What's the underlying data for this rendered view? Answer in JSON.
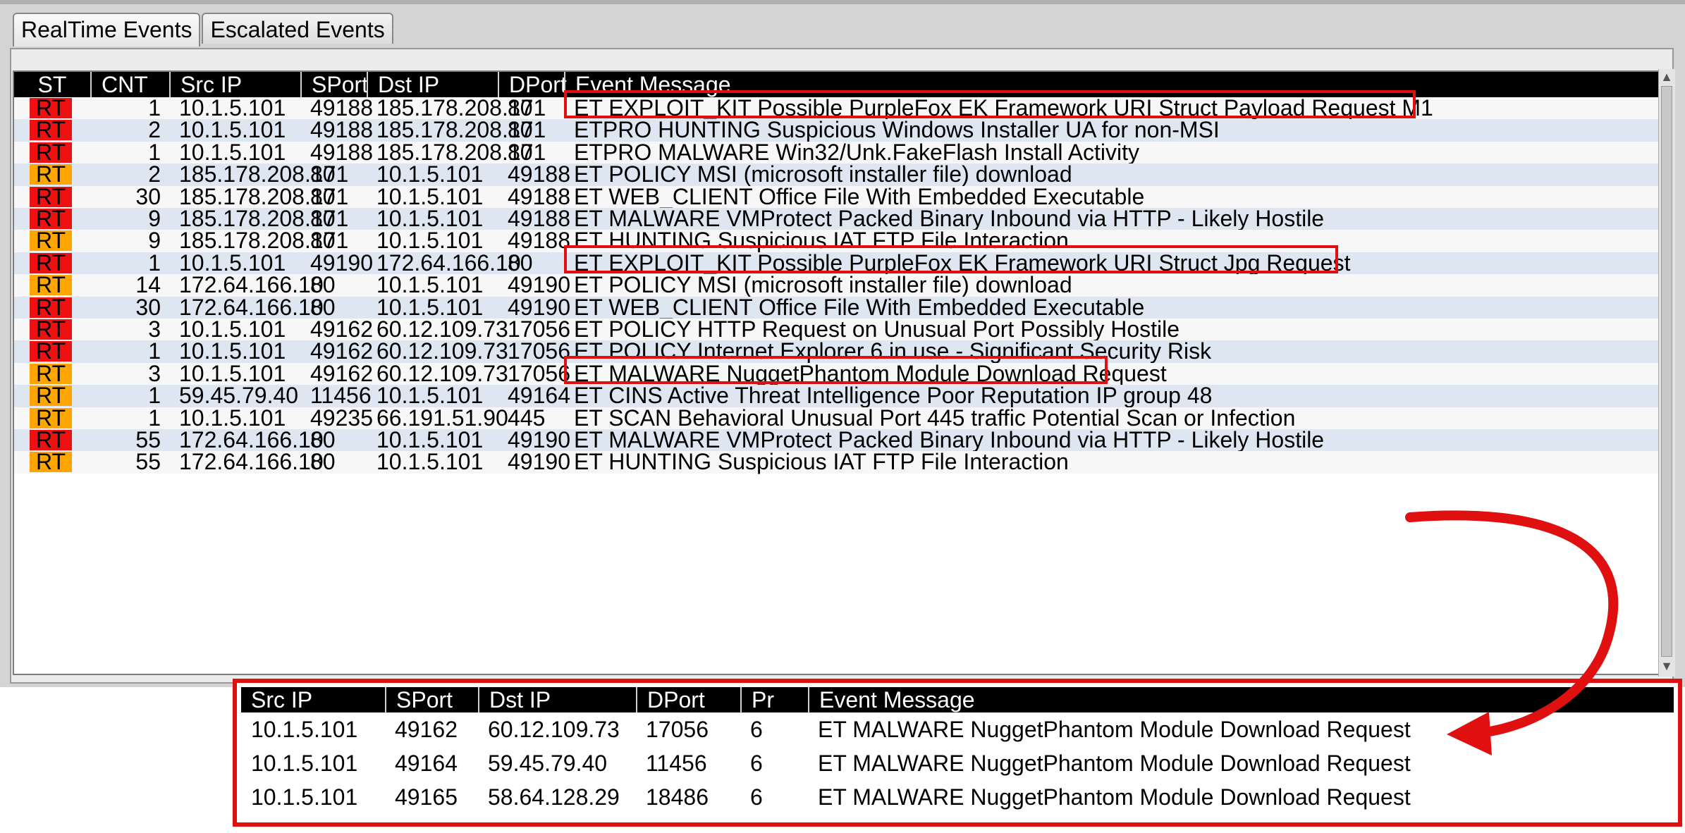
{
  "tabs": [
    {
      "label": "RealTime Events",
      "active": true
    },
    {
      "label": "Escalated Events",
      "active": false
    }
  ],
  "columns": [
    "ST",
    "CNT",
    "Src IP",
    "SPort",
    "Dst IP",
    "DPort",
    "Event Message"
  ],
  "colors": {
    "rt_red": "#ee1111",
    "rt_orange": "#ffa500",
    "highlight": "#e01010",
    "row_alt": "#dde6f1"
  },
  "rows": [
    {
      "st": "RT",
      "level": "red",
      "cnt": "1",
      "src_ip": "10.1.5.101",
      "sport": "49188",
      "dst_ip": "185.178.208.171",
      "dport": "80",
      "msg": "ET EXPLOIT_KIT Possible PurpleFox EK Framework URI Struct Payload Request M1",
      "highlighted": true
    },
    {
      "st": "RT",
      "level": "red",
      "cnt": "2",
      "src_ip": "10.1.5.101",
      "sport": "49188",
      "dst_ip": "185.178.208.171",
      "dport": "80",
      "msg": "ETPRO HUNTING Suspicious Windows Installer UA for non-MSI"
    },
    {
      "st": "RT",
      "level": "red",
      "cnt": "1",
      "src_ip": "10.1.5.101",
      "sport": "49188",
      "dst_ip": "185.178.208.171",
      "dport": "80",
      "msg": "ETPRO MALWARE Win32/Unk.FakeFlash Install Activity"
    },
    {
      "st": "RT",
      "level": "orange",
      "cnt": "2",
      "src_ip": "185.178.208.171",
      "sport": "80",
      "dst_ip": "10.1.5.101",
      "dport": "49188",
      "msg": "ET POLICY MSI (microsoft installer file) download"
    },
    {
      "st": "RT",
      "level": "red",
      "cnt": "30",
      "src_ip": "185.178.208.171",
      "sport": "80",
      "dst_ip": "10.1.5.101",
      "dport": "49188",
      "msg": "ET WEB_CLIENT Office File With Embedded Executable"
    },
    {
      "st": "RT",
      "level": "red",
      "cnt": "9",
      "src_ip": "185.178.208.171",
      "sport": "80",
      "dst_ip": "10.1.5.101",
      "dport": "49188",
      "msg": "ET MALWARE VMProtect Packed Binary Inbound via HTTP - Likely Hostile"
    },
    {
      "st": "RT",
      "level": "orange",
      "cnt": "9",
      "src_ip": "185.178.208.171",
      "sport": "80",
      "dst_ip": "10.1.5.101",
      "dport": "49188",
      "msg": "ET HUNTING Suspicious IAT FTP File Interaction"
    },
    {
      "st": "RT",
      "level": "red",
      "cnt": "1",
      "src_ip": "10.1.5.101",
      "sport": "49190",
      "dst_ip": "172.64.166.10",
      "dport": "80",
      "msg": "ET EXPLOIT_KIT Possible PurpleFox EK Framework URI Struct Jpg Request",
      "highlighted": true
    },
    {
      "st": "RT",
      "level": "orange",
      "cnt": "14",
      "src_ip": "172.64.166.10",
      "sport": "80",
      "dst_ip": "10.1.5.101",
      "dport": "49190",
      "msg": "ET POLICY MSI (microsoft installer file) download"
    },
    {
      "st": "RT",
      "level": "red",
      "cnt": "30",
      "src_ip": "172.64.166.10",
      "sport": "80",
      "dst_ip": "10.1.5.101",
      "dport": "49190",
      "msg": "ET WEB_CLIENT Office File With Embedded Executable"
    },
    {
      "st": "RT",
      "level": "red",
      "cnt": "3",
      "src_ip": "10.1.5.101",
      "sport": "49162",
      "dst_ip": "60.12.109.73",
      "dport": "17056",
      "msg": "ET POLICY HTTP Request on Unusual Port Possibly Hostile"
    },
    {
      "st": "RT",
      "level": "red",
      "cnt": "1",
      "src_ip": "10.1.5.101",
      "sport": "49162",
      "dst_ip": "60.12.109.73",
      "dport": "17056",
      "msg": "ET POLICY Internet Explorer 6 in use - Significant Security Risk"
    },
    {
      "st": "RT",
      "level": "orange",
      "cnt": "3",
      "src_ip": "10.1.5.101",
      "sport": "49162",
      "dst_ip": "60.12.109.73",
      "dport": "17056",
      "msg": "ET MALWARE NuggetPhantom Module Download Request",
      "highlighted": true
    },
    {
      "st": "RT",
      "level": "orange",
      "cnt": "1",
      "src_ip": "59.45.79.40",
      "sport": "11456",
      "dst_ip": "10.1.5.101",
      "dport": "49164",
      "msg": "ET CINS Active Threat Intelligence Poor Reputation IP group 48"
    },
    {
      "st": "RT",
      "level": "orange",
      "cnt": "1",
      "src_ip": "10.1.5.101",
      "sport": "49235",
      "dst_ip": "66.191.51.90",
      "dport": "445",
      "msg": "ET SCAN Behavioral Unusual Port 445 traffic Potential Scan or Infection"
    },
    {
      "st": "RT",
      "level": "red",
      "cnt": "55",
      "src_ip": "172.64.166.10",
      "sport": "80",
      "dst_ip": "10.1.5.101",
      "dport": "49190",
      "msg": "ET MALWARE VMProtect Packed Binary Inbound via HTTP - Likely Hostile"
    },
    {
      "st": "RT",
      "level": "orange",
      "cnt": "55",
      "src_ip": "172.64.166.10",
      "sport": "80",
      "dst_ip": "10.1.5.101",
      "dport": "49190",
      "msg": "ET HUNTING Suspicious IAT FTP File Interaction"
    }
  ],
  "inset": {
    "columns": [
      "Src IP",
      "SPort",
      "Dst IP",
      "DPort",
      "Pr",
      "Event Message"
    ],
    "rows": [
      {
        "src_ip": "10.1.5.101",
        "sport": "49162",
        "dst_ip": "60.12.109.73",
        "dport": "17056",
        "pr": "6",
        "msg": "ET MALWARE NuggetPhantom Module Download Request"
      },
      {
        "src_ip": "10.1.5.101",
        "sport": "49164",
        "dst_ip": "59.45.79.40",
        "dport": "11456",
        "pr": "6",
        "msg": "ET MALWARE NuggetPhantom Module Download Request"
      },
      {
        "src_ip": "10.1.5.101",
        "sport": "49165",
        "dst_ip": "58.64.128.29",
        "dport": "18486",
        "pr": "6",
        "msg": "ET MALWARE NuggetPhantom Module Download Request"
      }
    ]
  }
}
